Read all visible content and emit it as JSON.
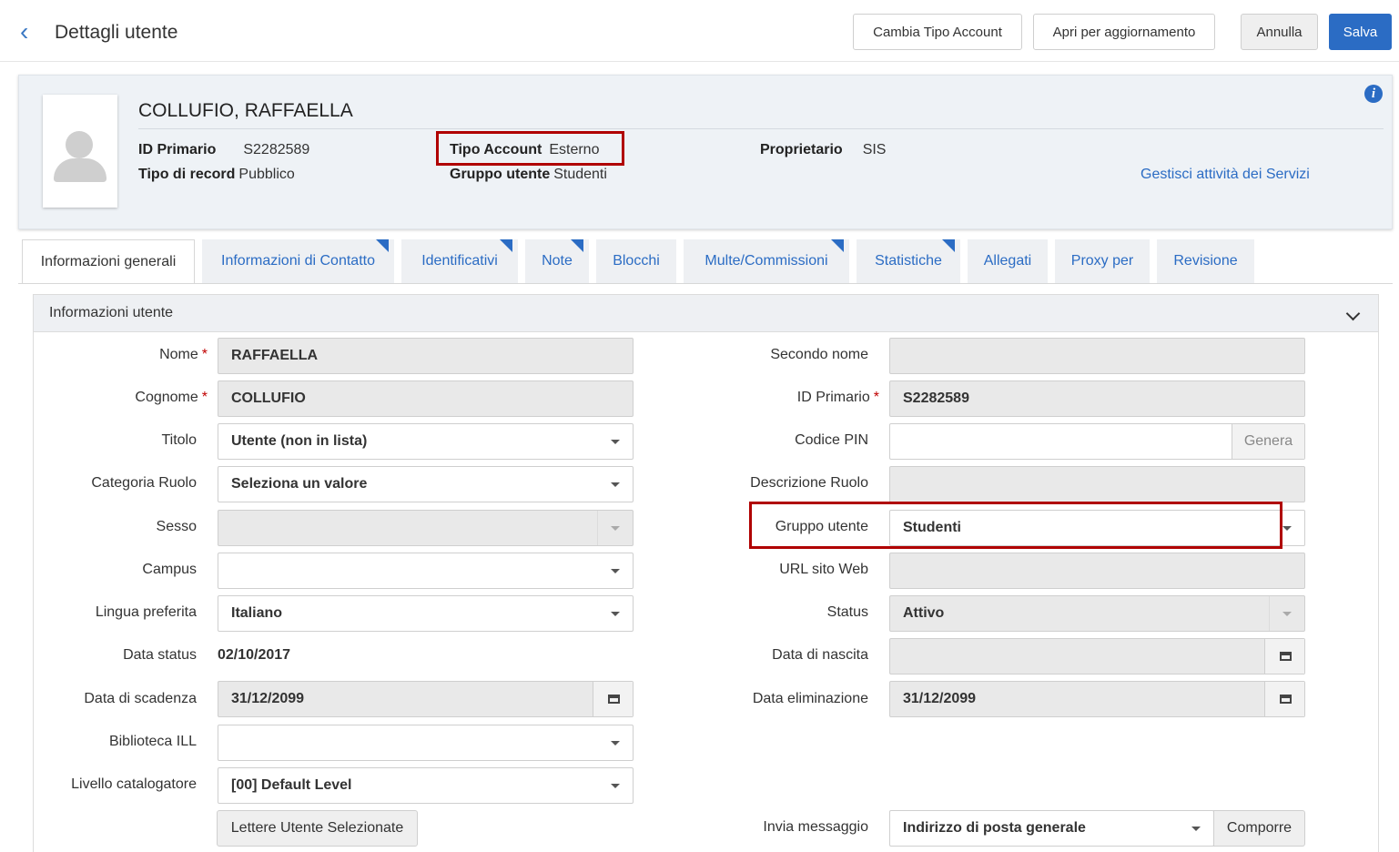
{
  "header": {
    "back_icon": "chevron-left-icon",
    "title": "Dettagli utente",
    "buttons": {
      "change_account_type": "Cambia Tipo Account",
      "open_for_update": "Apri per aggiornamento",
      "cancel": "Annulla",
      "save": "Salva"
    }
  },
  "summary": {
    "name": "COLLUFIO, RAFFAELLA",
    "primary_id_label": "ID Primario",
    "primary_id": "S2282589",
    "record_type_label": "Tipo di record",
    "record_type": "Pubblico",
    "account_type_label": "Tipo Account",
    "account_type": "Esterno",
    "user_group_label": "Gruppo utente",
    "user_group": "Studenti",
    "owner_label": "Proprietario",
    "owner": "SIS",
    "manage_link": "Gestisci attività dei Servizi",
    "info_icon": "info-icon"
  },
  "tabs": [
    {
      "label": "Informazioni generali",
      "active": true
    },
    {
      "label": "Informazioni di Contatto",
      "corner": true
    },
    {
      "label": "Identificativi",
      "corner": true
    },
    {
      "label": "Note",
      "corner": true
    },
    {
      "label": "Blocchi"
    },
    {
      "label": "Multe/Commissioni",
      "corner": true
    },
    {
      "label": "Statistiche",
      "corner": true
    },
    {
      "label": "Allegati"
    },
    {
      "label": "Proxy per"
    },
    {
      "label": "Revisione"
    }
  ],
  "section": {
    "title": "Informazioni utente"
  },
  "form": {
    "first_name": {
      "label": "Nome",
      "value": "RAFFAELLA"
    },
    "last_name": {
      "label": "Cognome",
      "value": "COLLUFIO"
    },
    "title": {
      "label": "Titolo",
      "value": "Utente (non in lista)"
    },
    "role_category": {
      "label": "Categoria Ruolo",
      "value": "Seleziona un valore"
    },
    "gender": {
      "label": "Sesso",
      "value": ""
    },
    "campus": {
      "label": "Campus",
      "value": ""
    },
    "preferred_language": {
      "label": "Lingua preferita",
      "value": "Italiano"
    },
    "status_date": {
      "label": "Data status",
      "value": "02/10/2017"
    },
    "expiry_date": {
      "label": "Data di scadenza",
      "value": "31/12/2099"
    },
    "ill_library": {
      "label": "Biblioteca ILL",
      "value": ""
    },
    "cataloger_level": {
      "label": "Livello catalogatore",
      "value": "[00] Default Level"
    },
    "letters_button": "Lettere Utente Selezionate",
    "middle_name": {
      "label": "Secondo nome",
      "value": ""
    },
    "primary_id": {
      "label": "ID Primario",
      "value": "S2282589"
    },
    "pin_code": {
      "label": "Codice PIN",
      "value": "",
      "button": "Genera"
    },
    "role_description": {
      "label": "Descrizione Ruolo",
      "value": ""
    },
    "user_group": {
      "label": "Gruppo utente",
      "value": "Studenti"
    },
    "website_url": {
      "label": "URL sito Web",
      "value": ""
    },
    "status": {
      "label": "Status",
      "value": "Attivo"
    },
    "birth_date": {
      "label": "Data di nascita",
      "value": ""
    },
    "purge_date": {
      "label": "Data eliminazione",
      "value": "31/12/2099"
    },
    "send_message": {
      "label": "Invia messaggio",
      "value": "Indirizzo di posta generale",
      "button": "Comporre"
    }
  },
  "colors": {
    "accent": "#2b6cc4",
    "highlight": "#b00000",
    "required": "#c00000"
  }
}
